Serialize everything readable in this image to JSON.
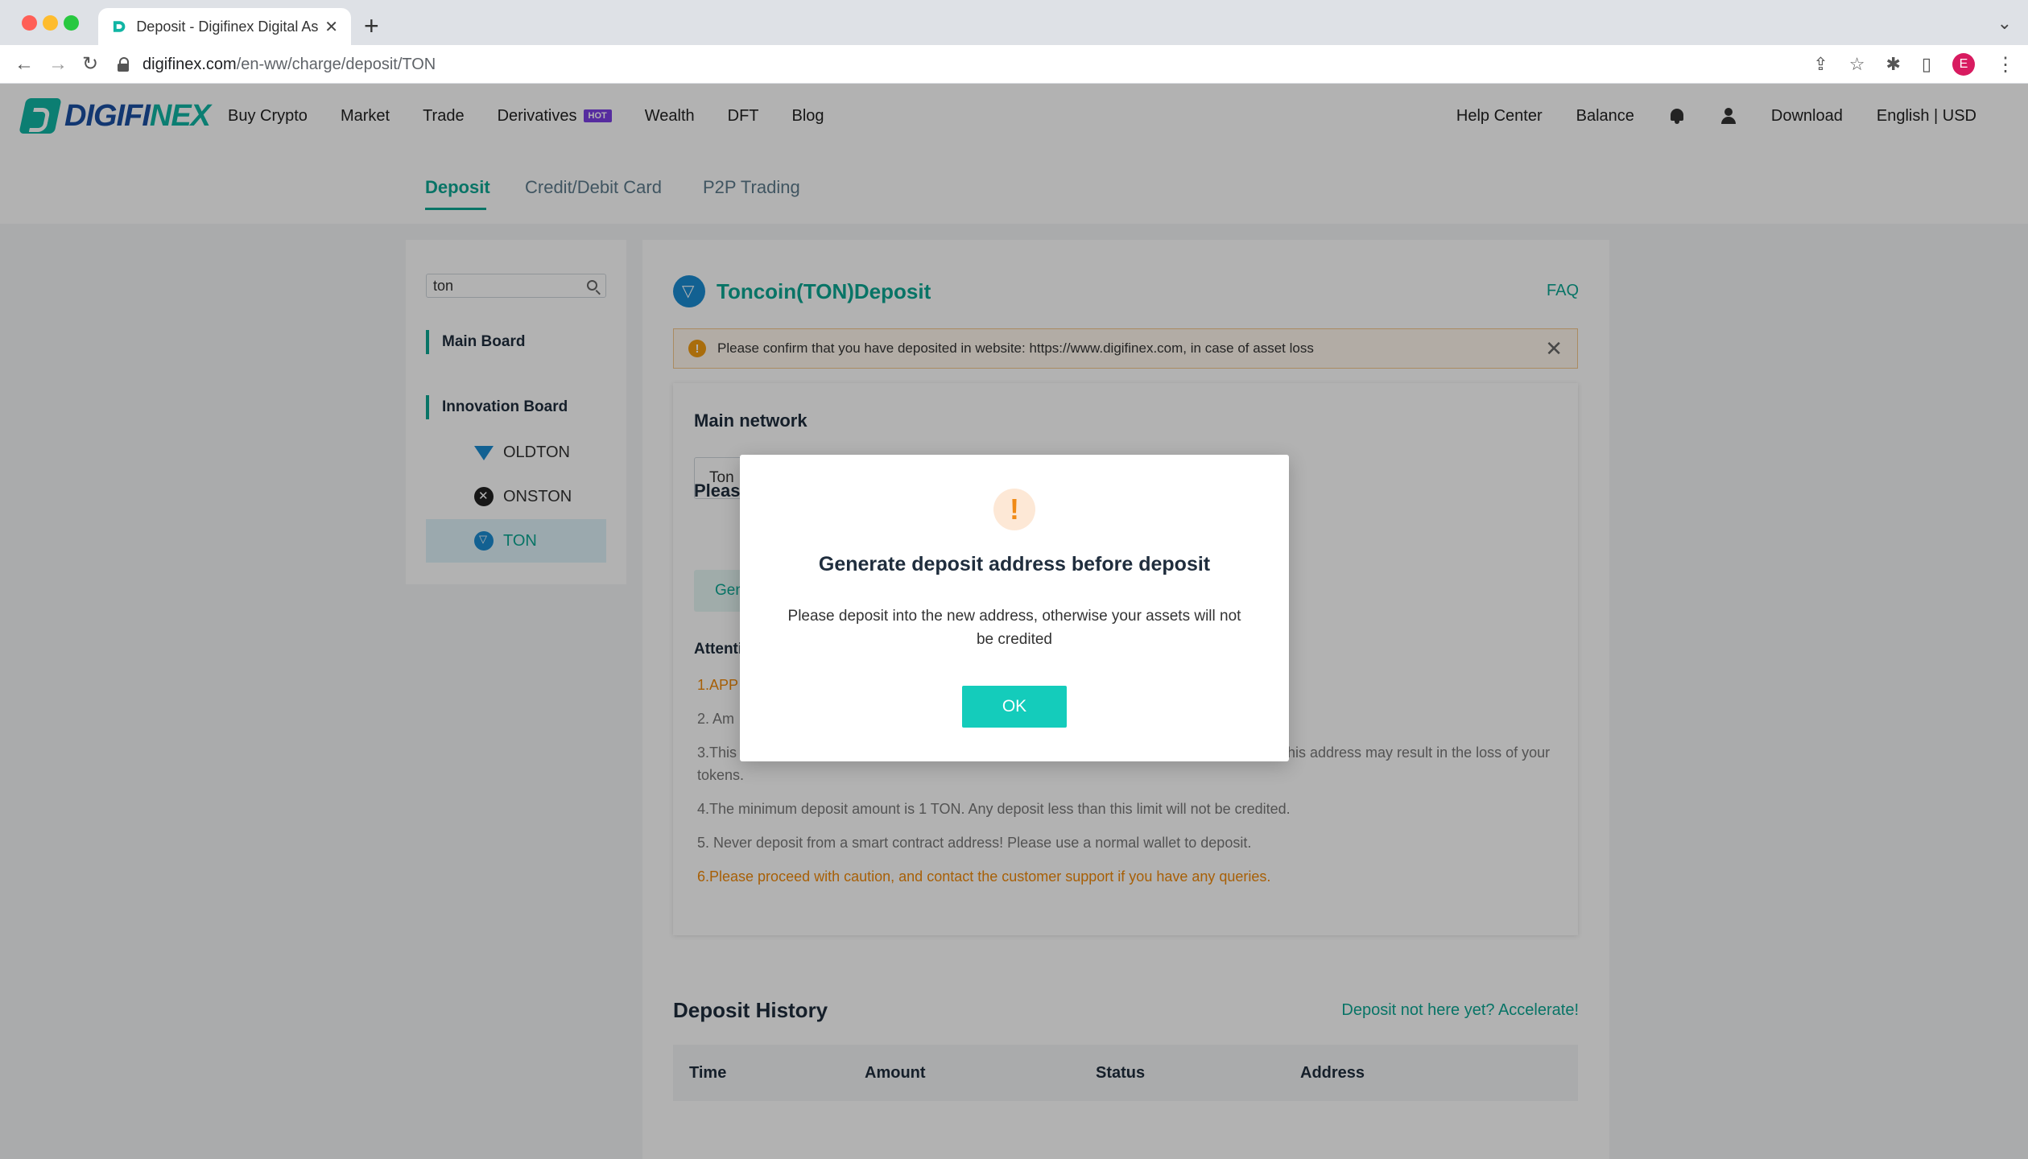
{
  "browser": {
    "tab_title": "Deposit - Digifinex Digital Asse",
    "tab_close": "✕",
    "new_tab": "+",
    "url_host": "digifinex.com",
    "url_path": "/en-ww/charge/deposit/TON",
    "profile_initial": "E",
    "icons": [
      "back-icon",
      "forward-icon",
      "reload-icon",
      "share-icon",
      "star-icon",
      "extensions-icon",
      "sidepanel-icon",
      "menu-icon"
    ]
  },
  "header": {
    "logo_part1": "DIGIFI",
    "logo_part2": "NEX",
    "nav": [
      {
        "label": "Buy Crypto"
      },
      {
        "label": "Market"
      },
      {
        "label": "Trade"
      },
      {
        "label": "Derivatives",
        "badge": "HOT"
      },
      {
        "label": "Wealth"
      },
      {
        "label": "DFT"
      },
      {
        "label": "Blog"
      }
    ],
    "help_center": "Help Center",
    "balance": "Balance",
    "download": "Download",
    "language": "English | USD"
  },
  "subtabs": {
    "deposit": "Deposit",
    "card": "Credit/Debit Card",
    "p2p": "P2P Trading"
  },
  "sidebar": {
    "search_value": "ton",
    "main_board": "Main Board",
    "innovation_board": "Innovation Board",
    "coins": [
      {
        "label": "OLDTON",
        "icon": "diamond-icon"
      },
      {
        "label": "ONSTON",
        "icon": "onston-icon"
      },
      {
        "label": "TON",
        "icon": "ton-icon",
        "selected": true
      }
    ]
  },
  "main": {
    "title": "Toncoin(TON)Deposit",
    "faq": "FAQ",
    "warning": "Please confirm that you have deposited in website: https://www.digifinex.com, in case of asset loss",
    "main_network_label": "Main network",
    "network_value": "Ton",
    "please_label": "Pleas",
    "generate_btn": "Gen",
    "attention_label": "Attenti",
    "attention": [
      "1.APP",
      "2. Am",
      "3.This",
      "his address may result in the loss of your",
      "tokens.",
      "4.The minimum deposit amount is 1 TON. Any deposit less than this limit will not be credited.",
      "5. Never deposit from a smart contract address! Please use a normal wallet to deposit.",
      "6.Please proceed with caution, and contact the customer support if you have any queries."
    ]
  },
  "history": {
    "title": "Deposit History",
    "accelerate": "Deposit not here yet? Accelerate!",
    "columns": [
      "Time",
      "Amount",
      "Status",
      "Address"
    ]
  },
  "modal": {
    "icon": "!",
    "title": "Generate deposit address before deposit",
    "text": "Please deposit into the new address, otherwise your assets will not be credited",
    "ok": "OK"
  }
}
